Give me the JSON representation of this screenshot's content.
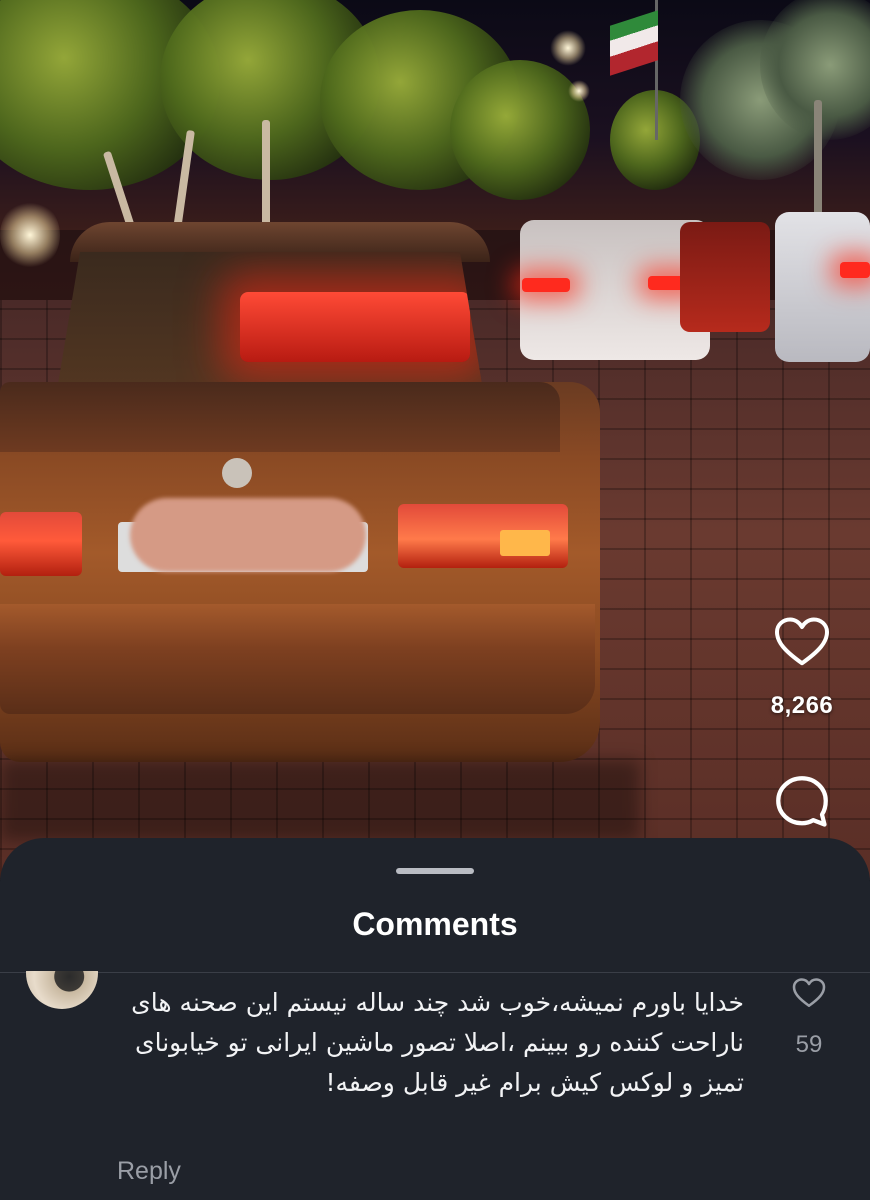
{
  "reel": {
    "like_icon": "heart-outline-icon",
    "like_count": "8,266",
    "comment_icon": "speech-bubble-icon"
  },
  "comments_sheet": {
    "title": "Comments",
    "comments": [
      {
        "text": "خدایا باورم نمیشه،خوب شد چند ساله نیستم این صحنه های ناراحت کننده رو ببینم ،اصلا تصور ماشین ایرانی تو خیابونای تمیز و لوکس کیش برام غیر قابل وصفه!",
        "reply_label": "Reply",
        "like_icon": "heart-outline-icon",
        "like_count": "59"
      }
    ]
  }
}
